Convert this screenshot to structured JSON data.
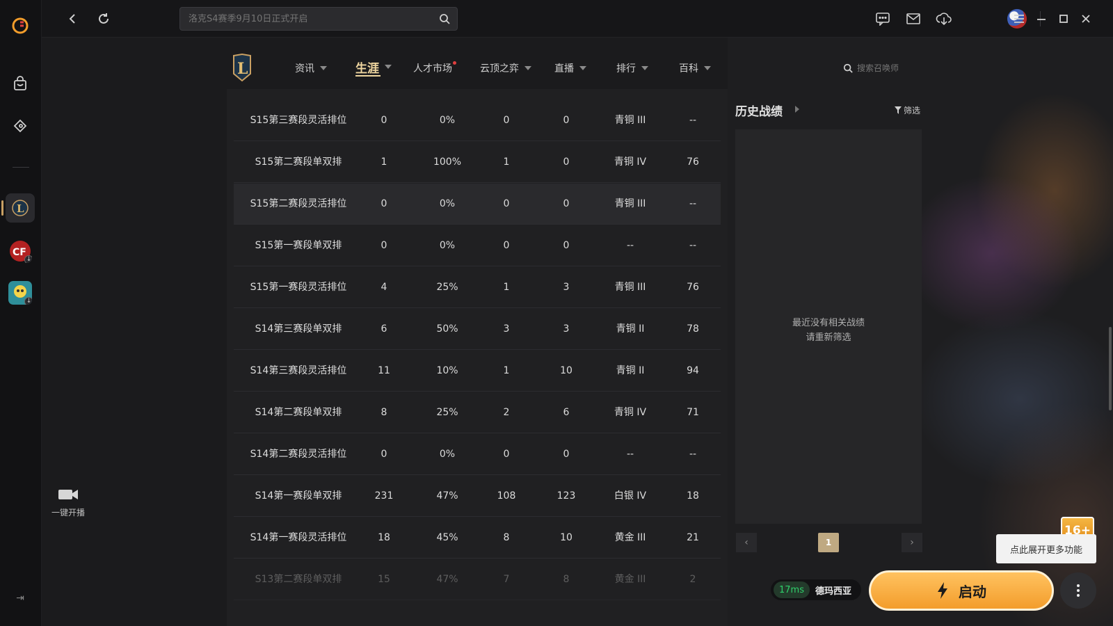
{
  "topbar": {
    "search_placeholder": "洛克S4赛季9月10日正式开启"
  },
  "nav": {
    "items": [
      {
        "label": "资讯",
        "has_caret": true
      },
      {
        "label": "生涯",
        "has_caret": true,
        "active": true
      },
      {
        "label": "人才市场",
        "has_dot": true
      },
      {
        "label": "云顶之弈",
        "has_caret": true
      },
      {
        "label": "直播",
        "has_caret": true
      },
      {
        "label": "排行",
        "has_caret": true
      },
      {
        "label": "百科",
        "has_caret": true
      }
    ],
    "summoner_search_placeholder": "搜索召唤师"
  },
  "ranked_table": {
    "rows": [
      {
        "season": "S15第三赛段灵活排位",
        "games": "0",
        "win_rate": "0%",
        "wins": "0",
        "losses": "0",
        "tier": "青铜 III",
        "score": "--"
      },
      {
        "season": "S15第二赛段单双排",
        "games": "1",
        "win_rate": "100%",
        "wins": "1",
        "losses": "0",
        "tier": "青铜 IV",
        "score": "76"
      },
      {
        "season": "S15第二赛段灵活排位",
        "games": "0",
        "win_rate": "0%",
        "wins": "0",
        "losses": "0",
        "tier": "青铜 III",
        "score": "--"
      },
      {
        "season": "S15第一赛段单双排",
        "games": "0",
        "win_rate": "0%",
        "wins": "0",
        "losses": "0",
        "tier": "--",
        "score": "--"
      },
      {
        "season": "S15第一赛段灵活排位",
        "games": "4",
        "win_rate": "25%",
        "wins": "1",
        "losses": "3",
        "tier": "青铜 III",
        "score": "76"
      },
      {
        "season": "S14第三赛段单双排",
        "games": "6",
        "win_rate": "50%",
        "wins": "3",
        "losses": "3",
        "tier": "青铜 II",
        "score": "78"
      },
      {
        "season": "S14第三赛段灵活排位",
        "games": "11",
        "win_rate": "10%",
        "wins": "1",
        "losses": "10",
        "tier": "青铜 II",
        "score": "94"
      },
      {
        "season": "S14第二赛段单双排",
        "games": "8",
        "win_rate": "25%",
        "wins": "2",
        "losses": "6",
        "tier": "青铜 IV",
        "score": "71"
      },
      {
        "season": "S14第二赛段灵活排位",
        "games": "0",
        "win_rate": "0%",
        "wins": "0",
        "losses": "0",
        "tier": "--",
        "score": "--"
      },
      {
        "season": "S14第一赛段单双排",
        "games": "231",
        "win_rate": "47%",
        "wins": "108",
        "losses": "123",
        "tier": "白银 IV",
        "score": "18"
      },
      {
        "season": "S14第一赛段灵活排位",
        "games": "18",
        "win_rate": "45%",
        "wins": "8",
        "losses": "10",
        "tier": "黄金 III",
        "score": "21"
      },
      {
        "season": "S13第二赛段单双排",
        "games": "15",
        "win_rate": "47%",
        "wins": "7",
        "losses": "8",
        "tier": "黄金 III",
        "score": "2"
      }
    ]
  },
  "history": {
    "title": "历史战绩",
    "filter_label": "筛选",
    "empty_line1": "最近没有相关战绩",
    "empty_line2": "请重新筛选",
    "current_page": "1"
  },
  "stream": {
    "label": "一键开播"
  },
  "launch": {
    "age_badge": "16+",
    "tooltip": "点此展开更多功能",
    "ping": "17ms",
    "server": "德玛西亚",
    "launch_label": "启动"
  },
  "colors": {
    "accent_gold": "#f0d7a0",
    "launch_orange": "#f39d2b",
    "ping_green": "#2fd06b",
    "notification_red": "#e04040"
  }
}
